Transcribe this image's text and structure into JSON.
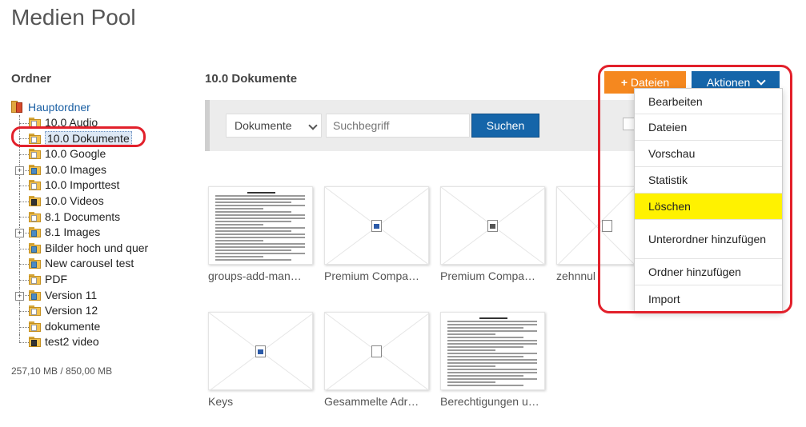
{
  "title": "Medien Pool",
  "sidebar": {
    "title": "Ordner",
    "root": "Hauptordner",
    "folders": [
      {
        "label": "10.0 Audio",
        "expandable": false,
        "icon": "folder-doc-icon"
      },
      {
        "label": "10.0 Dokumente",
        "expandable": false,
        "icon": "folder-doc-icon",
        "selected": true
      },
      {
        "label": "10.0 Google",
        "expandable": false,
        "icon": "folder-doc-icon"
      },
      {
        "label": "10.0 Images",
        "expandable": true,
        "icon": "folder-image-icon"
      },
      {
        "label": "10.0 Importtest",
        "expandable": false,
        "icon": "folder-doc-icon"
      },
      {
        "label": "10.0 Videos",
        "expandable": false,
        "icon": "folder-video-icon"
      },
      {
        "label": "8.1 Documents",
        "expandable": false,
        "icon": "folder-doc-icon"
      },
      {
        "label": "8.1 Images",
        "expandable": true,
        "icon": "folder-image-icon"
      },
      {
        "label": "Bilder hoch und quer",
        "expandable": false,
        "icon": "folder-image-icon"
      },
      {
        "label": "New carousel test",
        "expandable": false,
        "icon": "folder-image-icon"
      },
      {
        "label": "PDF",
        "expandable": false,
        "icon": "folder-doc-icon"
      },
      {
        "label": "Version 11",
        "expandable": true,
        "icon": "folder-image-icon"
      },
      {
        "label": "Version 12",
        "expandable": false,
        "icon": "folder-doc-icon"
      },
      {
        "label": "dokumente",
        "expandable": false,
        "icon": "folder-doc-icon"
      },
      {
        "label": "test2 video",
        "expandable": false,
        "icon": "folder-video-icon"
      }
    ],
    "storage": "257,10 MB / 850,00 MB"
  },
  "main": {
    "section_title": "10.0 Dokumente",
    "folder_select": "Dokumente",
    "search_placeholder": "Suchbegriff",
    "search_button": "Suchen",
    "files": [
      {
        "label": "groups-add-man…",
        "kind": "document-preview"
      },
      {
        "label": "Premium Compa…",
        "kind": "word"
      },
      {
        "label": "Premium Compa…",
        "kind": "ppt"
      },
      {
        "label": "zehnnul",
        "kind": "generic"
      },
      {
        "label": "Keys",
        "kind": "word"
      },
      {
        "label": "Gesammelte Adr…",
        "kind": "generic"
      },
      {
        "label": "Berechtigungen u…",
        "kind": "document-preview"
      }
    ]
  },
  "actions": {
    "upload_button": "Dateien",
    "actions_button": "Aktionen",
    "menu": [
      {
        "label": "Bearbeiten"
      },
      {
        "label": "Dateien"
      },
      {
        "label": "Vorschau"
      },
      {
        "label": "Statistik"
      },
      {
        "label": "Löschen",
        "active": true
      },
      {
        "label": "Unterordner hinzufügen"
      },
      {
        "label": "Ordner hinzufügen"
      },
      {
        "label": "Import"
      }
    ]
  },
  "colors": {
    "primary_blue": "#1565a9",
    "orange": "#f5881f",
    "highlight_yellow": "#fff200",
    "annotation_red": "#e2202b"
  }
}
